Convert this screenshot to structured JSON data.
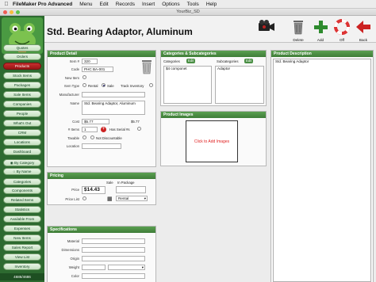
{
  "menubar": {
    "app_name": "FileMaker Pro Advanced",
    "items": [
      "Menu",
      "Edit",
      "Records",
      "Insert",
      "Options",
      "Tools",
      "Help"
    ]
  },
  "window": {
    "title": "YourBiz_SD"
  },
  "sidebar": {
    "nav": [
      "Quotes",
      "Orders",
      "Products",
      "Stock Items",
      "Packages",
      "Sale Items",
      "Companies",
      "People",
      "What's Out",
      "CRM",
      "Locations",
      "Dashboard"
    ],
    "filters": [
      "By Category",
      "By Name"
    ],
    "views": [
      "Categories",
      "Components",
      "Related Items",
      "Statistics",
      "Available From",
      "Expenses",
      "New Items",
      "Sales Report",
      "View List",
      "Inventory"
    ],
    "count": "4686/4686"
  },
  "header": {
    "title": "Std. Bearing Adaptor, Aluminum"
  },
  "toolbar": {
    "delete": "Delete",
    "add": "Add",
    "off": "Off",
    "back": "Back"
  },
  "product_detail": {
    "heading": "Product Detail",
    "item_no_label": "Item #",
    "item_no": "320",
    "code_label": "Code",
    "code": "PHC BA-001",
    "new_item_label": "New Item",
    "item_type_label": "Item Type",
    "rental": "Rental",
    "sale": "Sale",
    "track_inventory": "Track Inventory",
    "manufacturer_label": "Manufacturer",
    "manufacturer": "",
    "name_label": "Name",
    "name": "Std. Bearing Adaptor, Aluminum",
    "cost_label": "Cost",
    "cost": "$5.77",
    "cost_total": "$5.77",
    "items_label": "# Items",
    "items": "1",
    "has_serial_label": "Has Serial #s",
    "taxable_label": "Taxable",
    "not_discountable_label": "Not Discountable",
    "location_label": "Location",
    "location": ""
  },
  "pricing": {
    "heading": "Pricing",
    "sale_label": "Sale",
    "in_package_label": "In Package",
    "price_label": "Price",
    "price": "$14.43",
    "price_list_label": "Price List",
    "rental_option": "Rental"
  },
  "specifications": {
    "heading": "Specifications",
    "material_label": "Material",
    "dimensions_label": "Dimensions",
    "origin_label": "Origin",
    "weight_label": "Weight",
    "color_label": "Color"
  },
  "categories": {
    "heading": "Categories & Subcategories",
    "category_label": "Categories",
    "subcategory_label": "Subcategories",
    "edit": "Edit",
    "category_value": "$4 componet",
    "subcategory_value": "Adaptor"
  },
  "images": {
    "heading": "Product Images",
    "placeholder": "Click to Add Images"
  },
  "description": {
    "heading": "Product Description",
    "text": "Std. Bearing Adaptor"
  },
  "colors": {
    "sidebar": "#2d6a30",
    "header_green": "#4a8f44",
    "accent_red": "#c62f2f",
    "placeholder_red": "#e02020"
  }
}
